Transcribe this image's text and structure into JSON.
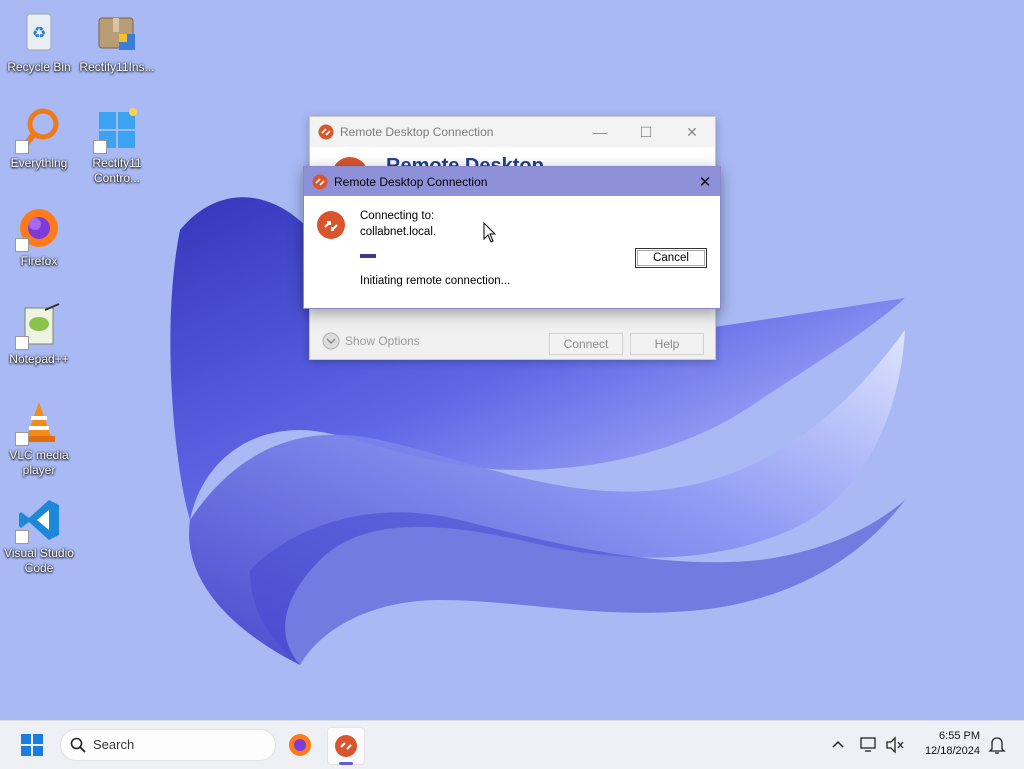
{
  "desktop": {
    "icons": [
      {
        "label": "Recycle Bin"
      },
      {
        "label": "Rectify11Ins..."
      },
      {
        "label": "Everything"
      },
      {
        "label": "Rectify11 Contro..."
      },
      {
        "label": "Firefox"
      },
      {
        "label": "Notepad++"
      },
      {
        "label": "VLC media player"
      },
      {
        "label": "Visual Studio Code"
      }
    ]
  },
  "rdc_main": {
    "title": "Remote Desktop Connection",
    "banner_title": "Remote Desktop",
    "show_options": "Show Options",
    "connect": "Connect",
    "help": "Help"
  },
  "dialog": {
    "title": "Remote Desktop Connection",
    "connecting_to": "Connecting to:",
    "host": "collabnet.local.",
    "status": "Initiating remote connection...",
    "cancel": "Cancel",
    "progress_percent": 5
  },
  "taskbar": {
    "search_placeholder": "Search",
    "time": "6:55 PM",
    "date": "12/18/2024",
    "pinned": [
      "firefox-icon",
      "remote-desktop-icon"
    ],
    "active_app": "remote-desktop-icon"
  },
  "colors": {
    "wallpaper": "#a9b9f4",
    "ribbon": "#4a4fd8",
    "dialog_titlebar": "#8e90d8",
    "rdc_accent": "#d9552e"
  }
}
